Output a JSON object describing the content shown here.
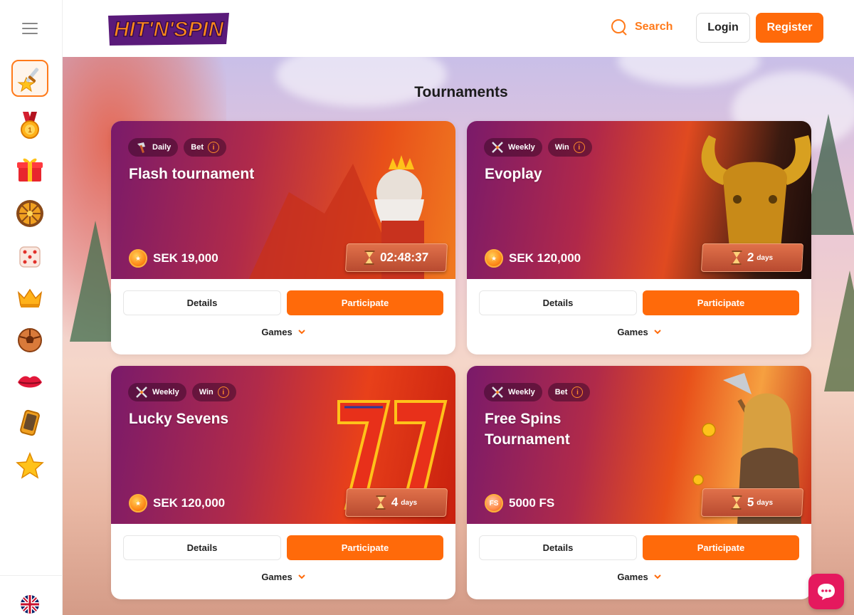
{
  "header": {
    "logo_text": "HIT'N'SPIN",
    "search_label": "Search",
    "login_label": "Login",
    "register_label": "Register"
  },
  "sidebar": {
    "items": [
      {
        "icon": "sword-star-icon",
        "active": true
      },
      {
        "icon": "medal-icon",
        "active": false
      },
      {
        "icon": "gift-icon",
        "active": false
      },
      {
        "icon": "wheel-icon",
        "active": false
      },
      {
        "icon": "dice-icon",
        "active": false
      },
      {
        "icon": "crown-icon",
        "active": false
      },
      {
        "icon": "soccer-ball-icon",
        "active": false
      },
      {
        "icon": "lips-icon",
        "active": false
      },
      {
        "icon": "mobile-phone-icon",
        "active": false
      },
      {
        "icon": "star-icon",
        "active": false
      }
    ],
    "language": "uk-flag-icon"
  },
  "page": {
    "title": "Tournaments"
  },
  "tournaments": [
    {
      "period": "Daily",
      "type": "Bet",
      "name": "Flash tournament",
      "prize": "SEK 19,000",
      "timer": "02:48:37",
      "timer_unit": "",
      "details_label": "Details",
      "participate_label": "Participate",
      "games_label": "Games"
    },
    {
      "period": "Weekly",
      "type": "Win",
      "name": "Evoplay",
      "prize": "SEK 120,000",
      "timer": "2",
      "timer_unit": "days",
      "details_label": "Details",
      "participate_label": "Participate",
      "games_label": "Games"
    },
    {
      "period": "Weekly",
      "type": "Win",
      "name": "Lucky Sevens",
      "prize": "SEK 120,000",
      "timer": "4",
      "timer_unit": "days",
      "details_label": "Details",
      "participate_label": "Participate",
      "games_label": "Games"
    },
    {
      "period": "Weekly",
      "type": "Bet",
      "name": "Free Spins Tournament",
      "prize": "5000 FS",
      "prize_icon_text": "FS",
      "timer": "5",
      "timer_unit": "days",
      "details_label": "Details",
      "participate_label": "Participate",
      "games_label": "Games"
    }
  ],
  "colors": {
    "accent": "#ff6a0a",
    "chat": "#e5195e"
  }
}
